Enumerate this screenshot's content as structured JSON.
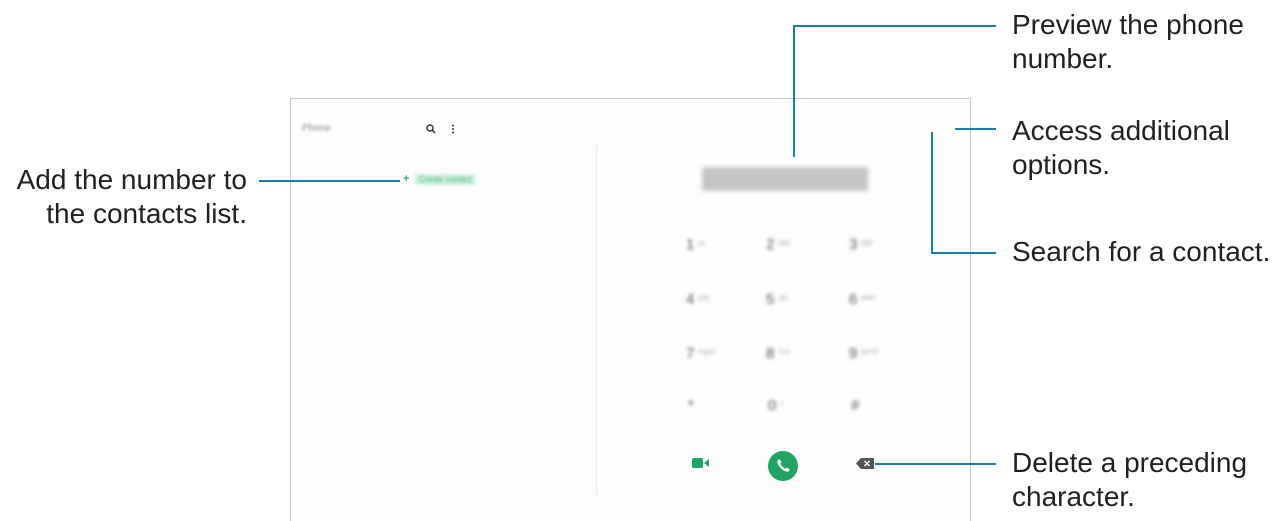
{
  "phone_screen": {
    "app_title": "Phone",
    "create_contact_label": "Create contact",
    "number_placeholder": "",
    "keypad": [
      {
        "digit": "1",
        "letters": "oo"
      },
      {
        "digit": "2",
        "letters": "ABC"
      },
      {
        "digit": "3",
        "letters": "DEF"
      },
      {
        "digit": "4",
        "letters": "GHI"
      },
      {
        "digit": "5",
        "letters": "JKL"
      },
      {
        "digit": "6",
        "letters": "MNO"
      },
      {
        "digit": "7",
        "letters": "PQRS"
      },
      {
        "digit": "8",
        "letters": "TUV"
      },
      {
        "digit": "9",
        "letters": "WXYZ"
      },
      {
        "digit": "*",
        "letters": ""
      },
      {
        "digit": "0",
        "letters": "+"
      },
      {
        "digit": "#",
        "letters": ""
      }
    ],
    "colors": {
      "accent_green": "#1fa463",
      "callout_line": "#1580ad"
    }
  },
  "callouts": {
    "preview_line1": "Preview the phone",
    "preview_line2": "number.",
    "options_line1": "Access additional",
    "options_line2": "options.",
    "add_line1": "Add the number to",
    "add_line2": "the contacts list.",
    "search": "Search for a contact.",
    "delete_line1": "Delete a preceding",
    "delete_line2": "character."
  }
}
